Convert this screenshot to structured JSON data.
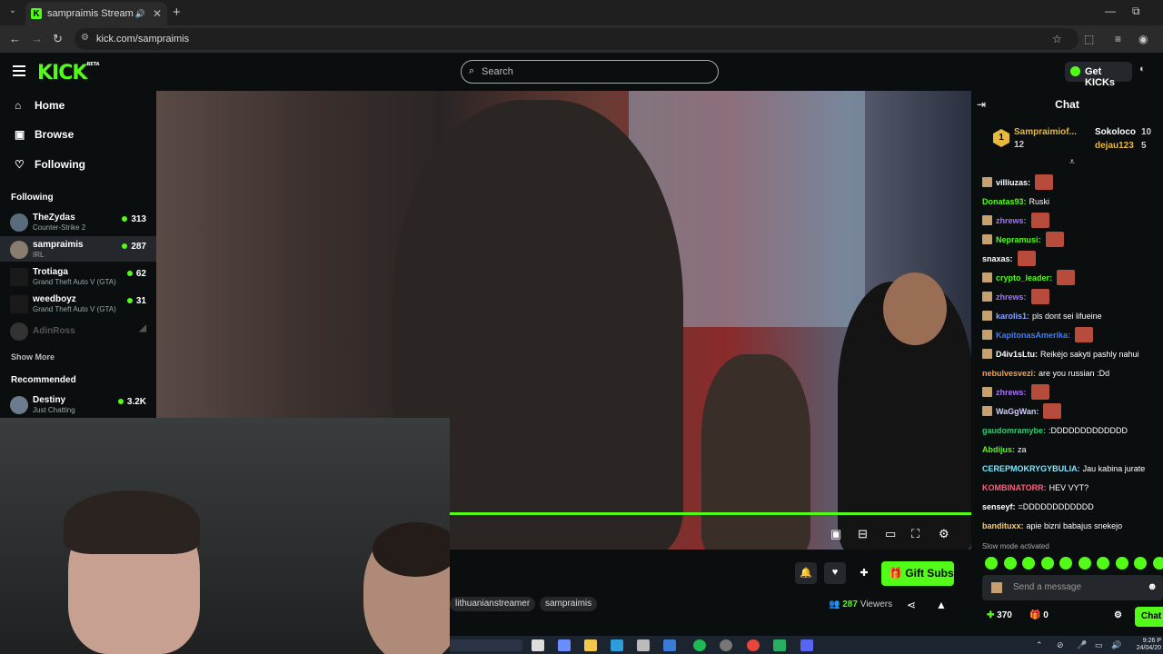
{
  "browser": {
    "tab_title": "sampraimis Stream - Watch",
    "url": "kick.com/sampraimis"
  },
  "header": {
    "logo": "KICK",
    "logo_badge": "BETA",
    "search_placeholder": "Search",
    "get_kicks_label": "Get KICKs"
  },
  "sidebar": {
    "nav": [
      {
        "label": "Home",
        "icon": "home-icon"
      },
      {
        "label": "Browse",
        "icon": "browse-icon"
      },
      {
        "label": "Following",
        "icon": "heart-icon"
      }
    ],
    "following_title": "Following",
    "following": [
      {
        "name": "TheZydas",
        "category": "Counter-Strike 2",
        "viewers": "313"
      },
      {
        "name": "sampraimis",
        "category": "IRL",
        "viewers": "287"
      },
      {
        "name": "Trotiaga",
        "category": "Grand Theft Auto V (GTA)",
        "viewers": "62"
      },
      {
        "name": "weedboyz",
        "category": "Grand Theft Auto V (GTA)",
        "viewers": "31"
      },
      {
        "name": "AdinRoss",
        "category": "",
        "viewers": ""
      }
    ],
    "show_more": "Show More",
    "recommended_title": "Recommended",
    "recommended": [
      {
        "name": "Destiny",
        "category": "Just Chatting",
        "viewers": "3.2K"
      }
    ]
  },
  "stream": {
    "progress": 1.0,
    "gift_subs_label": "Gift Subs",
    "tags": [
      "lithuanianstreamer",
      "sampraimis"
    ],
    "viewers_count": "287",
    "viewers_label": "Viewers"
  },
  "chat": {
    "title": "Chat",
    "top_gifters": [
      {
        "rank": "1",
        "name": "Sampraimiof...",
        "count": "12"
      },
      {
        "name": "Sokoloco",
        "count": "10"
      },
      {
        "name": "dejau123",
        "count": "5"
      }
    ],
    "messages": [
      {
        "user": "villiuzas:",
        "text": "",
        "color": "#ffffff",
        "emote": true
      },
      {
        "user": "Donatas93:",
        "text": "Ruski",
        "color": "#53fc18",
        "emote": false
      },
      {
        "user": "zhrews:",
        "text": "",
        "color": "#a970ff",
        "emote": true
      },
      {
        "user": "Nepramusi:",
        "text": "",
        "color": "#53fc18",
        "emote": true
      },
      {
        "user": "snaxas:",
        "text": "",
        "color": "#ffffff",
        "emote": true
      },
      {
        "user": "crypto_leader:",
        "text": "",
        "color": "#53fc18",
        "emote": true
      },
      {
        "user": "zhrews:",
        "text": "",
        "color": "#a970ff",
        "emote": true
      },
      {
        "user": "karolis1:",
        "text": "pls dont sei lifueine",
        "color": "#8aa4ff",
        "emote": false
      },
      {
        "user": "KapitonasAmerika:",
        "text": "",
        "color": "#3b7cff",
        "emote": true
      },
      {
        "user": "D4iv1sLtu:",
        "text": "Reikėjo sakyti pashly nahui",
        "color": "#ffffff",
        "emote": false
      },
      {
        "user": "nebulvesvezi:",
        "text": "are you russian :Dd",
        "color": "#ff9f40",
        "emote": false
      },
      {
        "user": "zhrews:",
        "text": "",
        "color": "#a970ff",
        "emote": true
      },
      {
        "user": "WaGgWan:",
        "text": "",
        "color": "#cfcfff",
        "emote": true
      },
      {
        "user": "gaudomramybe:",
        "text": ":DDDDDDDDDDDDD",
        "color": "#2ecc71",
        "emote": false
      },
      {
        "user": "Abdijus:",
        "text": "za",
        "color": "#53fc18",
        "emote": false
      },
      {
        "user": "CEREPMOKRYGYBULIA:",
        "text": "Jau kabina jurate",
        "color": "#7ee8ff",
        "emote": false
      },
      {
        "user": "KOMBINATORR:",
        "text": "HEV VYT?",
        "color": "#ff5e7e",
        "emote": false
      },
      {
        "user": "senseyf:",
        "text": "=DDDDDDDDDDDD",
        "color": "#ffffff",
        "emote": false
      },
      {
        "user": "bandituxx:",
        "text": "apie bizni babajus snekejo",
        "color": "#ffcc66",
        "emote": false
      }
    ],
    "slow_mode": "Slow mode activated",
    "input_placeholder": "Send a message",
    "kicks_count": "370",
    "gift_count": "0",
    "send_label": "Chat"
  },
  "taskbar": {
    "time": "9:26 P",
    "date": "24/04/20"
  }
}
